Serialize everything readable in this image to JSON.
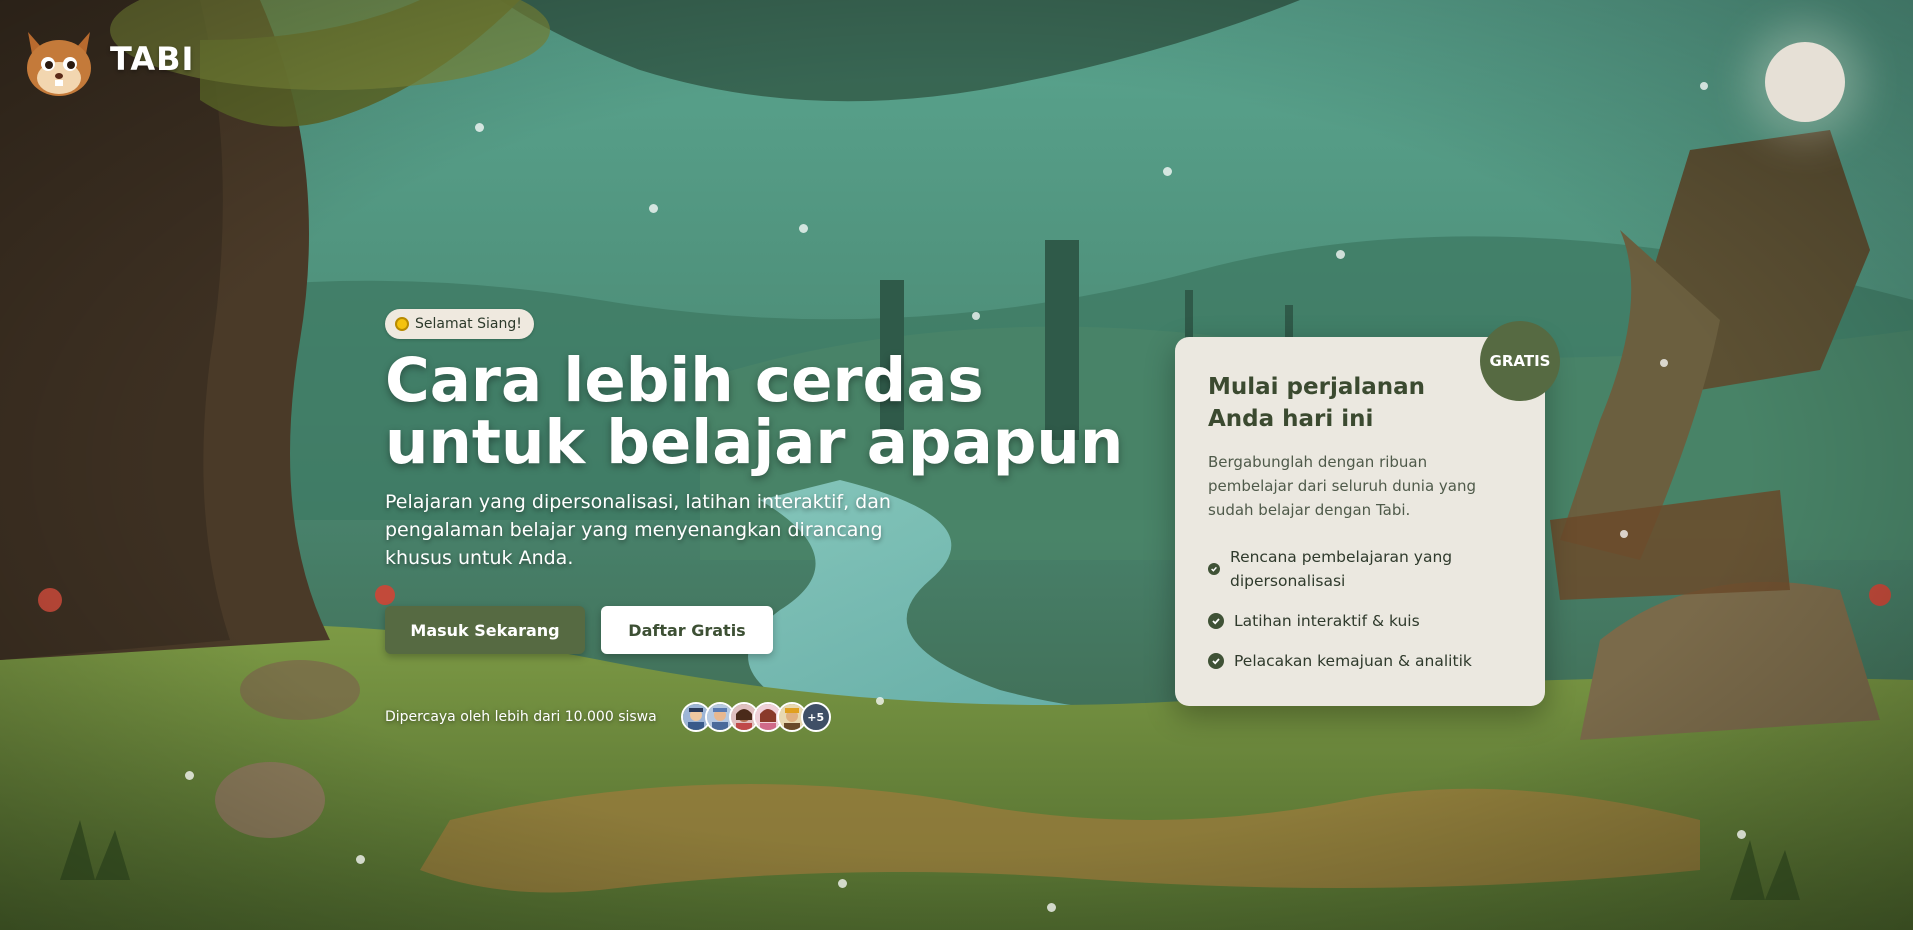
{
  "brand": {
    "name": "TABI",
    "logo_icon": "squirrel-logo-icon"
  },
  "hero": {
    "greeting": "Selamat Siang!",
    "greeting_icon": "sun-icon",
    "title": "Cara lebih cerdas untuk belajar apapun",
    "subtitle": "Pelajaran yang dipersonalisasi, latihan interaktif, dan pengalaman belajar yang menyenangkan dirancang khusus untuk Anda.",
    "primary_button": "Masuk Sekarang",
    "secondary_button": "Daftar Gratis",
    "trust_text": "Dipercaya oleh lebih dari 10.000 siswa",
    "avatar_more": "+5"
  },
  "card": {
    "badge": "GRATIS",
    "title": "Mulai perjalanan Anda hari ini",
    "description": "Bergabunglah dengan ribuan pembelajar dari seluruh dunia yang sudah belajar dengan Tabi.",
    "features": [
      "Rencana pembelajaran yang dipersonalisasi",
      "Latihan interaktif & kuis",
      "Pelacakan kemajuan & analitik"
    ]
  },
  "colors": {
    "accent": "#566a42",
    "card_bg": "#ebe8e0",
    "check": "#3f5236"
  }
}
